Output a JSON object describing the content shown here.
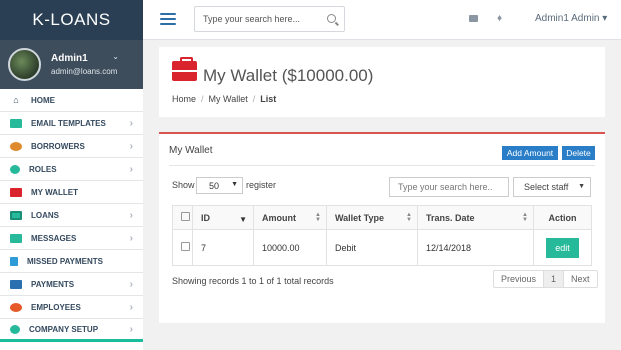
{
  "brand": "K-LOANS",
  "profile": {
    "name": "Admin1",
    "email": "admin@loans.com"
  },
  "menu": [
    {
      "label": "HOME",
      "icon": "home-icon"
    },
    {
      "label": "EMAIL TEMPLATES",
      "icon": "envelope-icon"
    },
    {
      "label": "BORROWERS",
      "icon": "users-icon"
    },
    {
      "label": "ROLES",
      "icon": "roles-icon"
    },
    {
      "label": "MY WALLET",
      "icon": "briefcase-icon"
    },
    {
      "label": "LOANS",
      "icon": "money-icon"
    },
    {
      "label": "MESSAGES",
      "icon": "envelope-icon"
    },
    {
      "label": "MISSED PAYMENTS",
      "icon": "payment-icon"
    },
    {
      "label": "PAYMENTS",
      "icon": "paypal-icon"
    },
    {
      "label": "EMPLOYEES",
      "icon": "employees-icon"
    },
    {
      "label": "COMPANY SETUP",
      "icon": "cogs-icon"
    }
  ],
  "topbar": {
    "search_placeholder": "Type your search here...",
    "user": "Admin1 Admin"
  },
  "page": {
    "title": "My Wallet ($10000.00)",
    "breadcrumb": [
      "Home",
      "My Wallet",
      "List"
    ]
  },
  "wallet_card": {
    "title": "My Wallet",
    "add_label": "Add Amount",
    "delete_label": "Delete",
    "show_label": "Show",
    "page_size": "50",
    "register_label": "register",
    "table_search_placeholder": "Type your search here..",
    "staff_select": "Select staff",
    "columns": [
      "ID",
      "Amount",
      "Wallet Type",
      "Trans. Date",
      "Action"
    ],
    "rows": [
      {
        "id": "7",
        "amount": "10000.00",
        "wallet_type": "Debit",
        "trans_date": "12/14/2018",
        "action": "edit"
      }
    ],
    "showing": "Showing records 1 to 1 of 1 total records",
    "pager": {
      "prev": "Previous",
      "page": "1",
      "next": "Next"
    }
  },
  "colors": {
    "sidebar_dark": "#2a3f54",
    "accent_red": "#d9232d",
    "primary_blue": "#2a7ec7",
    "green": "#26b99a"
  }
}
